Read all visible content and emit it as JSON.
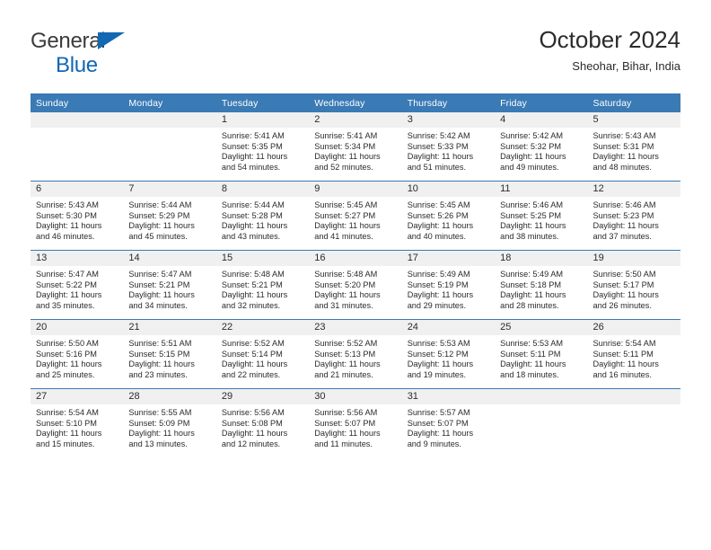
{
  "brand": {
    "name_top": "General",
    "name_bottom": "Blue",
    "accent_color": "#1268b3",
    "triangle_icon": "triangle-icon"
  },
  "header": {
    "title": "October 2024",
    "subtitle": "Sheohar, Bihar, India"
  },
  "calendar": {
    "header_bg": "#3a7ab5",
    "header_text_color": "#ffffff",
    "daynum_band_bg": "#f0f0f0",
    "weekday_headers": [
      "Sunday",
      "Monday",
      "Tuesday",
      "Wednesday",
      "Thursday",
      "Friday",
      "Saturday"
    ],
    "weeks": [
      [
        {
          "day": "",
          "lines": []
        },
        {
          "day": "",
          "lines": []
        },
        {
          "day": "1",
          "lines": [
            "Sunrise: 5:41 AM",
            "Sunset: 5:35 PM",
            "Daylight: 11 hours",
            "and 54 minutes."
          ]
        },
        {
          "day": "2",
          "lines": [
            "Sunrise: 5:41 AM",
            "Sunset: 5:34 PM",
            "Daylight: 11 hours",
            "and 52 minutes."
          ]
        },
        {
          "day": "3",
          "lines": [
            "Sunrise: 5:42 AM",
            "Sunset: 5:33 PM",
            "Daylight: 11 hours",
            "and 51 minutes."
          ]
        },
        {
          "day": "4",
          "lines": [
            "Sunrise: 5:42 AM",
            "Sunset: 5:32 PM",
            "Daylight: 11 hours",
            "and 49 minutes."
          ]
        },
        {
          "day": "5",
          "lines": [
            "Sunrise: 5:43 AM",
            "Sunset: 5:31 PM",
            "Daylight: 11 hours",
            "and 48 minutes."
          ]
        }
      ],
      [
        {
          "day": "6",
          "lines": [
            "Sunrise: 5:43 AM",
            "Sunset: 5:30 PM",
            "Daylight: 11 hours",
            "and 46 minutes."
          ]
        },
        {
          "day": "7",
          "lines": [
            "Sunrise: 5:44 AM",
            "Sunset: 5:29 PM",
            "Daylight: 11 hours",
            "and 45 minutes."
          ]
        },
        {
          "day": "8",
          "lines": [
            "Sunrise: 5:44 AM",
            "Sunset: 5:28 PM",
            "Daylight: 11 hours",
            "and 43 minutes."
          ]
        },
        {
          "day": "9",
          "lines": [
            "Sunrise: 5:45 AM",
            "Sunset: 5:27 PM",
            "Daylight: 11 hours",
            "and 41 minutes."
          ]
        },
        {
          "day": "10",
          "lines": [
            "Sunrise: 5:45 AM",
            "Sunset: 5:26 PM",
            "Daylight: 11 hours",
            "and 40 minutes."
          ]
        },
        {
          "day": "11",
          "lines": [
            "Sunrise: 5:46 AM",
            "Sunset: 5:25 PM",
            "Daylight: 11 hours",
            "and 38 minutes."
          ]
        },
        {
          "day": "12",
          "lines": [
            "Sunrise: 5:46 AM",
            "Sunset: 5:23 PM",
            "Daylight: 11 hours",
            "and 37 minutes."
          ]
        }
      ],
      [
        {
          "day": "13",
          "lines": [
            "Sunrise: 5:47 AM",
            "Sunset: 5:22 PM",
            "Daylight: 11 hours",
            "and 35 minutes."
          ]
        },
        {
          "day": "14",
          "lines": [
            "Sunrise: 5:47 AM",
            "Sunset: 5:21 PM",
            "Daylight: 11 hours",
            "and 34 minutes."
          ]
        },
        {
          "day": "15",
          "lines": [
            "Sunrise: 5:48 AM",
            "Sunset: 5:21 PM",
            "Daylight: 11 hours",
            "and 32 minutes."
          ]
        },
        {
          "day": "16",
          "lines": [
            "Sunrise: 5:48 AM",
            "Sunset: 5:20 PM",
            "Daylight: 11 hours",
            "and 31 minutes."
          ]
        },
        {
          "day": "17",
          "lines": [
            "Sunrise: 5:49 AM",
            "Sunset: 5:19 PM",
            "Daylight: 11 hours",
            "and 29 minutes."
          ]
        },
        {
          "day": "18",
          "lines": [
            "Sunrise: 5:49 AM",
            "Sunset: 5:18 PM",
            "Daylight: 11 hours",
            "and 28 minutes."
          ]
        },
        {
          "day": "19",
          "lines": [
            "Sunrise: 5:50 AM",
            "Sunset: 5:17 PM",
            "Daylight: 11 hours",
            "and 26 minutes."
          ]
        }
      ],
      [
        {
          "day": "20",
          "lines": [
            "Sunrise: 5:50 AM",
            "Sunset: 5:16 PM",
            "Daylight: 11 hours",
            "and 25 minutes."
          ]
        },
        {
          "day": "21",
          "lines": [
            "Sunrise: 5:51 AM",
            "Sunset: 5:15 PM",
            "Daylight: 11 hours",
            "and 23 minutes."
          ]
        },
        {
          "day": "22",
          "lines": [
            "Sunrise: 5:52 AM",
            "Sunset: 5:14 PM",
            "Daylight: 11 hours",
            "and 22 minutes."
          ]
        },
        {
          "day": "23",
          "lines": [
            "Sunrise: 5:52 AM",
            "Sunset: 5:13 PM",
            "Daylight: 11 hours",
            "and 21 minutes."
          ]
        },
        {
          "day": "24",
          "lines": [
            "Sunrise: 5:53 AM",
            "Sunset: 5:12 PM",
            "Daylight: 11 hours",
            "and 19 minutes."
          ]
        },
        {
          "day": "25",
          "lines": [
            "Sunrise: 5:53 AM",
            "Sunset: 5:11 PM",
            "Daylight: 11 hours",
            "and 18 minutes."
          ]
        },
        {
          "day": "26",
          "lines": [
            "Sunrise: 5:54 AM",
            "Sunset: 5:11 PM",
            "Daylight: 11 hours",
            "and 16 minutes."
          ]
        }
      ],
      [
        {
          "day": "27",
          "lines": [
            "Sunrise: 5:54 AM",
            "Sunset: 5:10 PM",
            "Daylight: 11 hours",
            "and 15 minutes."
          ]
        },
        {
          "day": "28",
          "lines": [
            "Sunrise: 5:55 AM",
            "Sunset: 5:09 PM",
            "Daylight: 11 hours",
            "and 13 minutes."
          ]
        },
        {
          "day": "29",
          "lines": [
            "Sunrise: 5:56 AM",
            "Sunset: 5:08 PM",
            "Daylight: 11 hours",
            "and 12 minutes."
          ]
        },
        {
          "day": "30",
          "lines": [
            "Sunrise: 5:56 AM",
            "Sunset: 5:07 PM",
            "Daylight: 11 hours",
            "and 11 minutes."
          ]
        },
        {
          "day": "31",
          "lines": [
            "Sunrise: 5:57 AM",
            "Sunset: 5:07 PM",
            "Daylight: 11 hours",
            "and 9 minutes."
          ]
        },
        {
          "day": "",
          "lines": []
        },
        {
          "day": "",
          "lines": []
        }
      ]
    ]
  }
}
